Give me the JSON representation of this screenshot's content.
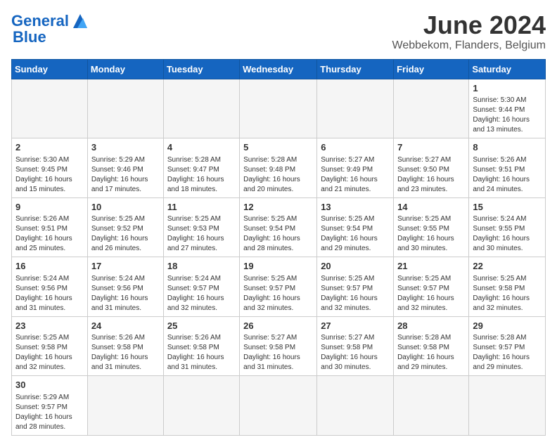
{
  "header": {
    "logo_general": "General",
    "logo_blue": "Blue",
    "month_title": "June 2024",
    "location": "Webbekom, Flanders, Belgium"
  },
  "weekdays": [
    "Sunday",
    "Monday",
    "Tuesday",
    "Wednesday",
    "Thursday",
    "Friday",
    "Saturday"
  ],
  "weeks": [
    [
      {
        "day": "",
        "info": ""
      },
      {
        "day": "",
        "info": ""
      },
      {
        "day": "",
        "info": ""
      },
      {
        "day": "",
        "info": ""
      },
      {
        "day": "",
        "info": ""
      },
      {
        "day": "",
        "info": ""
      },
      {
        "day": "1",
        "info": "Sunrise: 5:30 AM\nSunset: 9:44 PM\nDaylight: 16 hours and 13 minutes."
      }
    ],
    [
      {
        "day": "2",
        "info": "Sunrise: 5:30 AM\nSunset: 9:45 PM\nDaylight: 16 hours and 15 minutes."
      },
      {
        "day": "3",
        "info": "Sunrise: 5:29 AM\nSunset: 9:46 PM\nDaylight: 16 hours and 17 minutes."
      },
      {
        "day": "4",
        "info": "Sunrise: 5:28 AM\nSunset: 9:47 PM\nDaylight: 16 hours and 18 minutes."
      },
      {
        "day": "5",
        "info": "Sunrise: 5:28 AM\nSunset: 9:48 PM\nDaylight: 16 hours and 20 minutes."
      },
      {
        "day": "6",
        "info": "Sunrise: 5:27 AM\nSunset: 9:49 PM\nDaylight: 16 hours and 21 minutes."
      },
      {
        "day": "7",
        "info": "Sunrise: 5:27 AM\nSunset: 9:50 PM\nDaylight: 16 hours and 23 minutes."
      },
      {
        "day": "8",
        "info": "Sunrise: 5:26 AM\nSunset: 9:51 PM\nDaylight: 16 hours and 24 minutes."
      }
    ],
    [
      {
        "day": "9",
        "info": "Sunrise: 5:26 AM\nSunset: 9:51 PM\nDaylight: 16 hours and 25 minutes."
      },
      {
        "day": "10",
        "info": "Sunrise: 5:25 AM\nSunset: 9:52 PM\nDaylight: 16 hours and 26 minutes."
      },
      {
        "day": "11",
        "info": "Sunrise: 5:25 AM\nSunset: 9:53 PM\nDaylight: 16 hours and 27 minutes."
      },
      {
        "day": "12",
        "info": "Sunrise: 5:25 AM\nSunset: 9:54 PM\nDaylight: 16 hours and 28 minutes."
      },
      {
        "day": "13",
        "info": "Sunrise: 5:25 AM\nSunset: 9:54 PM\nDaylight: 16 hours and 29 minutes."
      },
      {
        "day": "14",
        "info": "Sunrise: 5:25 AM\nSunset: 9:55 PM\nDaylight: 16 hours and 30 minutes."
      },
      {
        "day": "15",
        "info": "Sunrise: 5:24 AM\nSunset: 9:55 PM\nDaylight: 16 hours and 30 minutes."
      }
    ],
    [
      {
        "day": "16",
        "info": "Sunrise: 5:24 AM\nSunset: 9:56 PM\nDaylight: 16 hours and 31 minutes."
      },
      {
        "day": "17",
        "info": "Sunrise: 5:24 AM\nSunset: 9:56 PM\nDaylight: 16 hours and 31 minutes."
      },
      {
        "day": "18",
        "info": "Sunrise: 5:24 AM\nSunset: 9:57 PM\nDaylight: 16 hours and 32 minutes."
      },
      {
        "day": "19",
        "info": "Sunrise: 5:25 AM\nSunset: 9:57 PM\nDaylight: 16 hours and 32 minutes."
      },
      {
        "day": "20",
        "info": "Sunrise: 5:25 AM\nSunset: 9:57 PM\nDaylight: 16 hours and 32 minutes."
      },
      {
        "day": "21",
        "info": "Sunrise: 5:25 AM\nSunset: 9:57 PM\nDaylight: 16 hours and 32 minutes."
      },
      {
        "day": "22",
        "info": "Sunrise: 5:25 AM\nSunset: 9:58 PM\nDaylight: 16 hours and 32 minutes."
      }
    ],
    [
      {
        "day": "23",
        "info": "Sunrise: 5:25 AM\nSunset: 9:58 PM\nDaylight: 16 hours and 32 minutes."
      },
      {
        "day": "24",
        "info": "Sunrise: 5:26 AM\nSunset: 9:58 PM\nDaylight: 16 hours and 31 minutes."
      },
      {
        "day": "25",
        "info": "Sunrise: 5:26 AM\nSunset: 9:58 PM\nDaylight: 16 hours and 31 minutes."
      },
      {
        "day": "26",
        "info": "Sunrise: 5:27 AM\nSunset: 9:58 PM\nDaylight: 16 hours and 31 minutes."
      },
      {
        "day": "27",
        "info": "Sunrise: 5:27 AM\nSunset: 9:58 PM\nDaylight: 16 hours and 30 minutes."
      },
      {
        "day": "28",
        "info": "Sunrise: 5:28 AM\nSunset: 9:58 PM\nDaylight: 16 hours and 29 minutes."
      },
      {
        "day": "29",
        "info": "Sunrise: 5:28 AM\nSunset: 9:57 PM\nDaylight: 16 hours and 29 minutes."
      }
    ],
    [
      {
        "day": "30",
        "info": "Sunrise: 5:29 AM\nSunset: 9:57 PM\nDaylight: 16 hours and 28 minutes."
      },
      {
        "day": "",
        "info": ""
      },
      {
        "day": "",
        "info": ""
      },
      {
        "day": "",
        "info": ""
      },
      {
        "day": "",
        "info": ""
      },
      {
        "day": "",
        "info": ""
      },
      {
        "day": "",
        "info": ""
      }
    ]
  ]
}
